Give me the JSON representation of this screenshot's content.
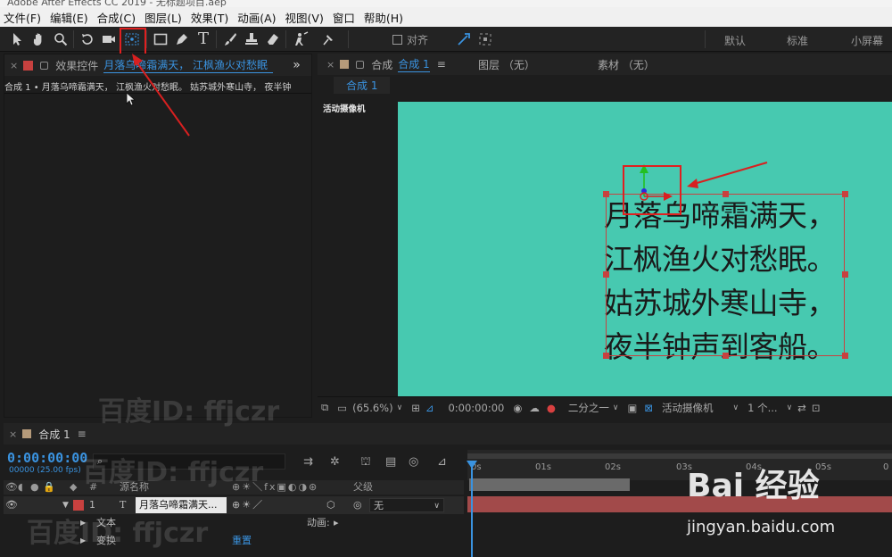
{
  "window": {
    "title": "Adobe After Effects CC 2019 - 无标题项目.aep"
  },
  "menu": [
    "文件(F)",
    "编辑(E)",
    "合成(C)",
    "图层(L)",
    "效果(T)",
    "动画(A)",
    "视图(V)",
    "窗口",
    "帮助(H)"
  ],
  "toolbar": {
    "align_label": "对齐",
    "workspaces": [
      "默认",
      "标准",
      "小屏幕"
    ]
  },
  "effects_panel": {
    "tab_label": "效果控件",
    "tab_layer": "月落乌啼霜满天， 江枫渔火对愁眠",
    "path_text": "合成 1 • 月落乌啼霜满天， 江枫渔火对愁眠。 姑苏城外寒山寺， 夜半钟"
  },
  "comp_panel": {
    "tab_prefix": "合成",
    "tab_name": "合成 1",
    "layer_tab": "图层 （无）",
    "footage_tab": "素材 （无）",
    "sub_tab": "合成 1",
    "camera_label": "活动摄像机",
    "poem_lines": [
      "月落乌啼霜满天，",
      "江枫渔火对愁眠。",
      "姑苏城外寒山寺，",
      "夜半钟声到客船。"
    ],
    "zoom": "(65.6%)",
    "time": "0:00:00:00",
    "resolution": "二分之一",
    "camera_select": "活动摄像机",
    "views_select": "1 个..."
  },
  "timeline": {
    "tab_label": "合成 1",
    "timecode": "0:00:00:00",
    "fps": "00000 (25.00 fps)",
    "col_source": "源名称",
    "col_parent": "父级",
    "col_num": "#",
    "layer": {
      "index": "1",
      "type_icon": "T",
      "name": "月落乌啼霜满天...",
      "parent": "无"
    },
    "rows": {
      "text": "文本",
      "transform": "变换",
      "animate": "动画:",
      "reset": "重置"
    },
    "ticks": [
      "0s",
      "01s",
      "02s",
      "03s",
      "04s",
      "05s",
      "0"
    ]
  },
  "watermarks": {
    "id_text": "百度ID: ffjczr",
    "logo": "Bai 经验",
    "url": "jingyan.baidu.com"
  },
  "colors": {
    "accent": "#3a93e0",
    "canvas": "#47c9b0",
    "layer_red": "#c8413f",
    "annotation": "#e02020"
  }
}
